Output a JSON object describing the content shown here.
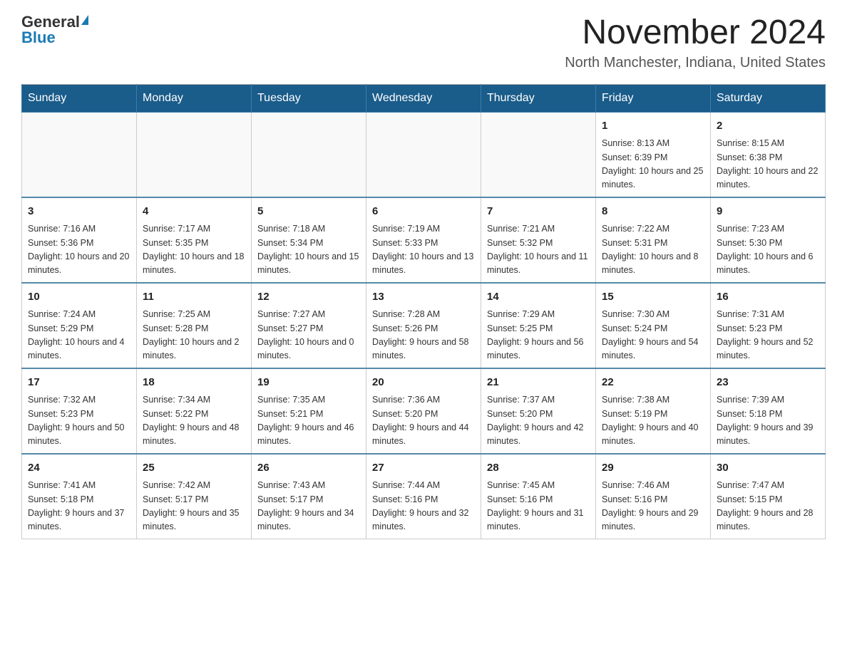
{
  "header": {
    "logo_general": "General",
    "logo_blue": "Blue",
    "month_title": "November 2024",
    "location": "North Manchester, Indiana, United States"
  },
  "days_of_week": [
    "Sunday",
    "Monday",
    "Tuesday",
    "Wednesday",
    "Thursday",
    "Friday",
    "Saturday"
  ],
  "weeks": [
    [
      {
        "day": "",
        "info": ""
      },
      {
        "day": "",
        "info": ""
      },
      {
        "day": "",
        "info": ""
      },
      {
        "day": "",
        "info": ""
      },
      {
        "day": "",
        "info": ""
      },
      {
        "day": "1",
        "info": "Sunrise: 8:13 AM\nSunset: 6:39 PM\nDaylight: 10 hours and 25 minutes."
      },
      {
        "day": "2",
        "info": "Sunrise: 8:15 AM\nSunset: 6:38 PM\nDaylight: 10 hours and 22 minutes."
      }
    ],
    [
      {
        "day": "3",
        "info": "Sunrise: 7:16 AM\nSunset: 5:36 PM\nDaylight: 10 hours and 20 minutes."
      },
      {
        "day": "4",
        "info": "Sunrise: 7:17 AM\nSunset: 5:35 PM\nDaylight: 10 hours and 18 minutes."
      },
      {
        "day": "5",
        "info": "Sunrise: 7:18 AM\nSunset: 5:34 PM\nDaylight: 10 hours and 15 minutes."
      },
      {
        "day": "6",
        "info": "Sunrise: 7:19 AM\nSunset: 5:33 PM\nDaylight: 10 hours and 13 minutes."
      },
      {
        "day": "7",
        "info": "Sunrise: 7:21 AM\nSunset: 5:32 PM\nDaylight: 10 hours and 11 minutes."
      },
      {
        "day": "8",
        "info": "Sunrise: 7:22 AM\nSunset: 5:31 PM\nDaylight: 10 hours and 8 minutes."
      },
      {
        "day": "9",
        "info": "Sunrise: 7:23 AM\nSunset: 5:30 PM\nDaylight: 10 hours and 6 minutes."
      }
    ],
    [
      {
        "day": "10",
        "info": "Sunrise: 7:24 AM\nSunset: 5:29 PM\nDaylight: 10 hours and 4 minutes."
      },
      {
        "day": "11",
        "info": "Sunrise: 7:25 AM\nSunset: 5:28 PM\nDaylight: 10 hours and 2 minutes."
      },
      {
        "day": "12",
        "info": "Sunrise: 7:27 AM\nSunset: 5:27 PM\nDaylight: 10 hours and 0 minutes."
      },
      {
        "day": "13",
        "info": "Sunrise: 7:28 AM\nSunset: 5:26 PM\nDaylight: 9 hours and 58 minutes."
      },
      {
        "day": "14",
        "info": "Sunrise: 7:29 AM\nSunset: 5:25 PM\nDaylight: 9 hours and 56 minutes."
      },
      {
        "day": "15",
        "info": "Sunrise: 7:30 AM\nSunset: 5:24 PM\nDaylight: 9 hours and 54 minutes."
      },
      {
        "day": "16",
        "info": "Sunrise: 7:31 AM\nSunset: 5:23 PM\nDaylight: 9 hours and 52 minutes."
      }
    ],
    [
      {
        "day": "17",
        "info": "Sunrise: 7:32 AM\nSunset: 5:23 PM\nDaylight: 9 hours and 50 minutes."
      },
      {
        "day": "18",
        "info": "Sunrise: 7:34 AM\nSunset: 5:22 PM\nDaylight: 9 hours and 48 minutes."
      },
      {
        "day": "19",
        "info": "Sunrise: 7:35 AM\nSunset: 5:21 PM\nDaylight: 9 hours and 46 minutes."
      },
      {
        "day": "20",
        "info": "Sunrise: 7:36 AM\nSunset: 5:20 PM\nDaylight: 9 hours and 44 minutes."
      },
      {
        "day": "21",
        "info": "Sunrise: 7:37 AM\nSunset: 5:20 PM\nDaylight: 9 hours and 42 minutes."
      },
      {
        "day": "22",
        "info": "Sunrise: 7:38 AM\nSunset: 5:19 PM\nDaylight: 9 hours and 40 minutes."
      },
      {
        "day": "23",
        "info": "Sunrise: 7:39 AM\nSunset: 5:18 PM\nDaylight: 9 hours and 39 minutes."
      }
    ],
    [
      {
        "day": "24",
        "info": "Sunrise: 7:41 AM\nSunset: 5:18 PM\nDaylight: 9 hours and 37 minutes."
      },
      {
        "day": "25",
        "info": "Sunrise: 7:42 AM\nSunset: 5:17 PM\nDaylight: 9 hours and 35 minutes."
      },
      {
        "day": "26",
        "info": "Sunrise: 7:43 AM\nSunset: 5:17 PM\nDaylight: 9 hours and 34 minutes."
      },
      {
        "day": "27",
        "info": "Sunrise: 7:44 AM\nSunset: 5:16 PM\nDaylight: 9 hours and 32 minutes."
      },
      {
        "day": "28",
        "info": "Sunrise: 7:45 AM\nSunset: 5:16 PM\nDaylight: 9 hours and 31 minutes."
      },
      {
        "day": "29",
        "info": "Sunrise: 7:46 AM\nSunset: 5:16 PM\nDaylight: 9 hours and 29 minutes."
      },
      {
        "day": "30",
        "info": "Sunrise: 7:47 AM\nSunset: 5:15 PM\nDaylight: 9 hours and 28 minutes."
      }
    ]
  ]
}
